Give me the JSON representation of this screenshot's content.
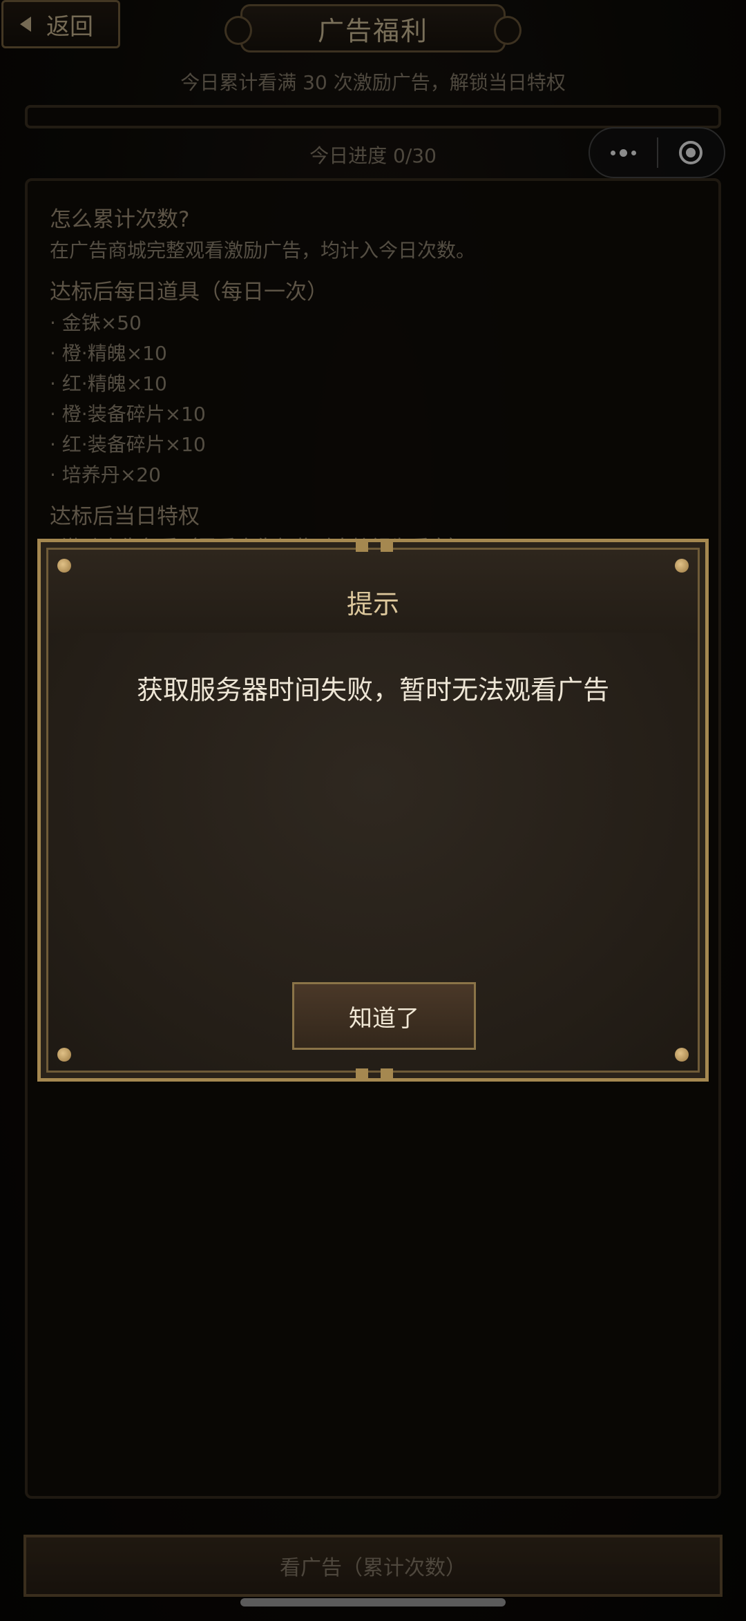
{
  "header": {
    "back_label": "返回",
    "title": "广告福利"
  },
  "subtitle": "今日累计看满 30 次激励广告，解锁当日特权",
  "progress": {
    "text": "今日进度 0/30",
    "value": 0,
    "max": 30
  },
  "info": {
    "section1_title": "怎么累计次数?",
    "section1_text": "在广告商城完整观看激励广告，均计入今日次数。",
    "section2_title": "达标后每日道具（每日一次）",
    "items": [
      "· 金铢×50",
      "· 橙·精魄×10",
      "· 红·精魄×10",
      "· 橙·装备碎片×10",
      "· 红·装备碎片×10",
      "· 培养丹×20"
    ],
    "section3_title": "达标后当日特权",
    "section3_text": "· 激励广告免看（需看广告领奖时直接视为看完）"
  },
  "dialog": {
    "title": "提示",
    "message": "获取服务器时间失败，暂时无法观看广告",
    "ok_label": "知道了"
  },
  "ad_button_label": "看广告（累计次数）",
  "colors": {
    "gold_border": "#a58850",
    "panel_bg": "#120e0a",
    "text_light": "#eee6d6"
  }
}
